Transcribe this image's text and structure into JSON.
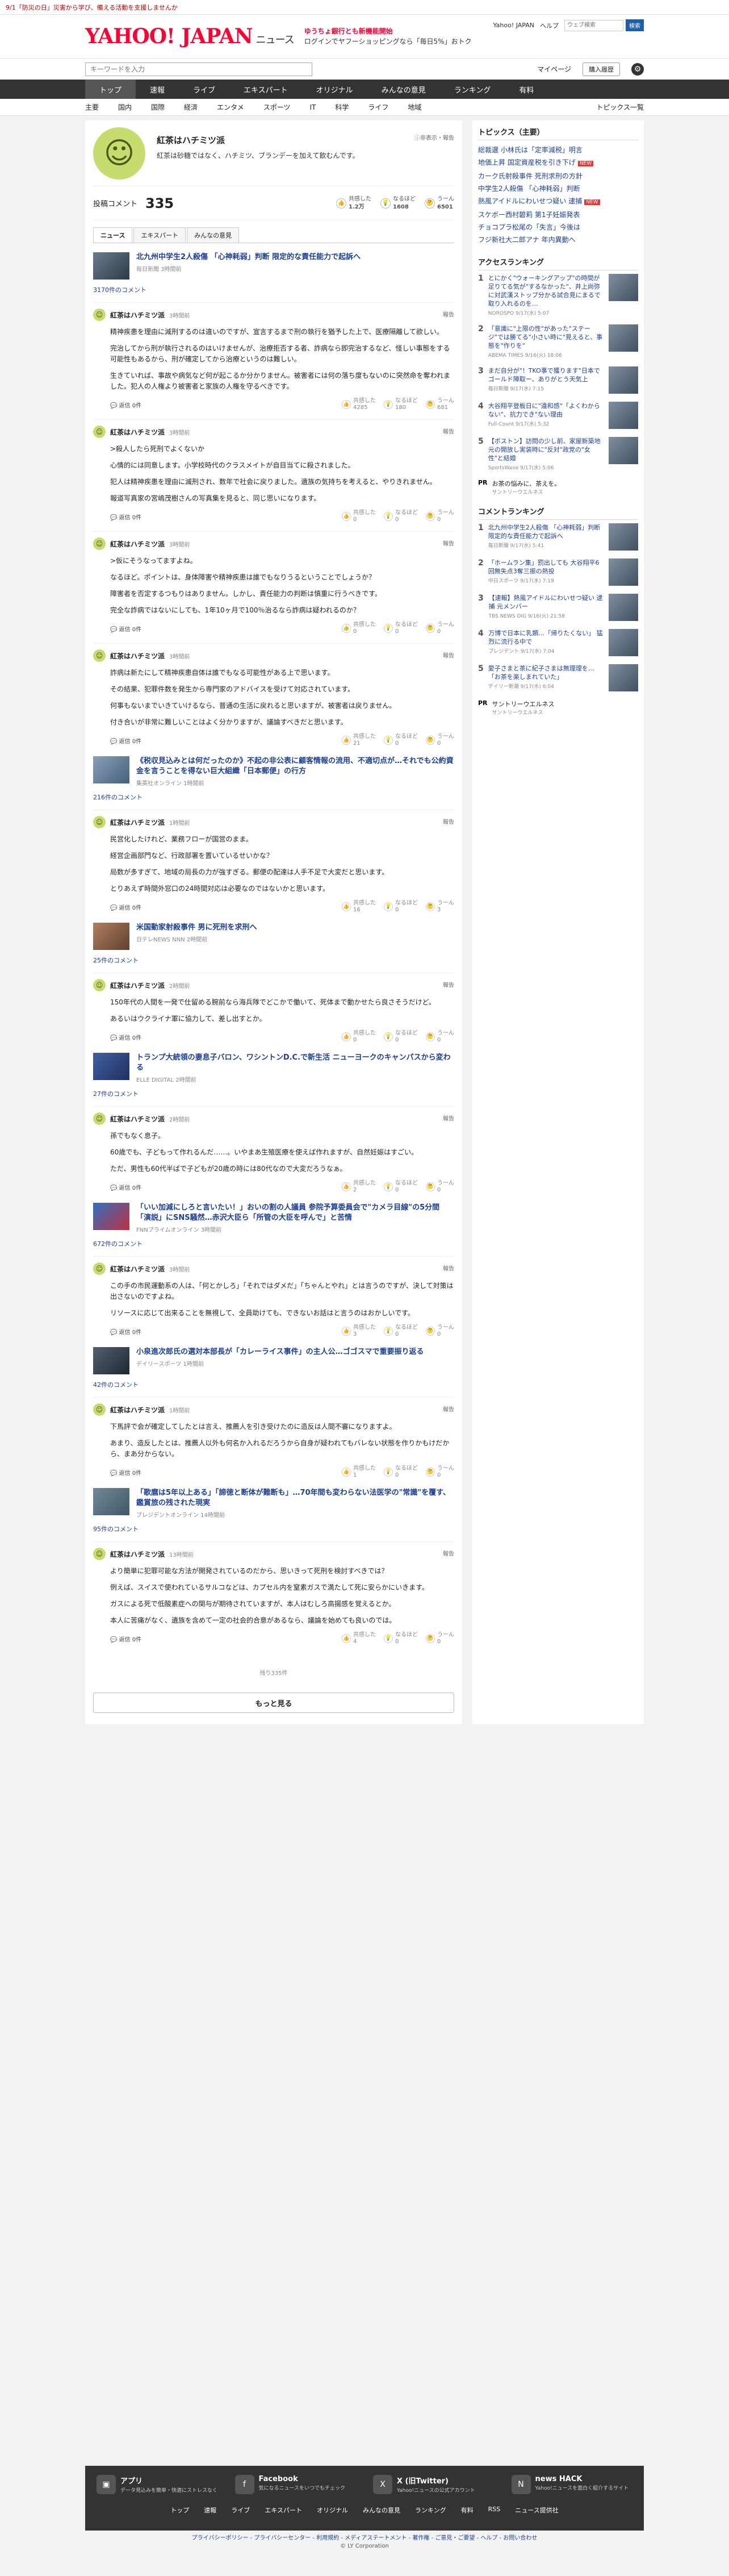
{
  "topbar": {
    "notice": "9/1「防災の日」災害から学び、備える活動を支援しませんか"
  },
  "header": {
    "logo": "YAHOO! JAPAN",
    "section": "ニュース",
    "promo_line1": "ゆうちょ銀行とも新機能開始",
    "promo_line2": "ログインでヤフーショッピングなら「毎日5%」おトク",
    "links": [
      "Yahoo! JAPAN",
      "ヘルプ"
    ],
    "search_placeholder": "ウェブ検索",
    "search_button": "検索"
  },
  "searchbar": {
    "placeholder": "キーワードを入力",
    "mypage": "マイページ",
    "entry": "購入履歴"
  },
  "nav": [
    "トップ",
    "速報",
    "ライブ",
    "エキスパート",
    "オリジナル",
    "みんなの意見",
    "ランキング",
    "有料"
  ],
  "subnav": [
    "主要",
    "国内",
    "国際",
    "経済",
    "エンタメ",
    "スポーツ",
    "IT",
    "科学",
    "ライフ",
    "地域"
  ],
  "subnav_more": "トピックス一覧",
  "profile": {
    "name": "紅茶はハチミツ派",
    "desc": "紅茶は砂糖ではなく、ハチミツ、ブランデーを加えて飲むんです。",
    "tools": "ⓘ非表示・報告",
    "post_label": "投稿コメント",
    "post_count": "335",
    "stats": [
      {
        "label": "共感した",
        "value": "1.2万"
      },
      {
        "label": "なるほど",
        "value": "1608"
      },
      {
        "label": "うーん",
        "value": "6501"
      }
    ],
    "tabs": [
      "ニュース",
      "エキスパート",
      "みんなの意見"
    ]
  },
  "feed": [
    {
      "title": "北九州中学生2人殺傷 「心神耗弱」判断 限定的な責任能力で起訴へ",
      "source": "毎日新聞 3時間前",
      "count": "3170件のコメント",
      "comment": {
        "name": "紅茶はハチミツ派",
        "time": "3時間前",
        "paras": [
          "精神疾患を理由に減刑するのは違いのですが、宣言するまで刑の執行を猶予した上で、医療隔離して欲しい。",
          "完治してから刑が執行されるのはいけませんが、治療拒否する者、詐病なら即完治するなど、怪しい事態をする可能性もあるから、刑が確定してから治療というのは難しい。",
          "生きていれば、事故や病気など何が起こるか分かりません。被害者には何の落ち度もないのに突然命を奪われました。犯人の人権より被害者と家族の人権を守るべきです。"
        ],
        "reacts": [
          "4285",
          "180",
          "681"
        ]
      }
    },
    {
      "title": "",
      "source": "",
      "count": "",
      "comment": {
        "name": "紅茶はハチミツ派",
        "time": "3時間前",
        "paras": [
          ">殺人したら死刑でよくないか",
          "心情的には同意します。小学校時代のクラスメイトが自目当てに殺されました。",
          "犯人は精神疾患を理由に減刑され、数年で社会に戻りました。遺族の気持ちを考えると、やりきれません。",
          "報道写真家の宮嶋茂樹さんの写真集を見ると、同じ思いになります。"
        ],
        "reacts": [
          "0",
          "0",
          "0"
        ]
      }
    },
    {
      "title": "",
      "source": "",
      "count": "",
      "comment": {
        "name": "紅茶はハチミツ派",
        "time": "3時間前",
        "paras": [
          ">仮にそうなってますよね。",
          "なるほど。ポイントは、身体障害や精神疾患は誰でもなりうるということでしょうか？",
          "障害者を否定するつもりはありません。しかし、責任能力の判断は慎重に行うべきです。",
          "完全な詐病ではないにしても、1年10ヶ月で100％治るなら詐病は疑われるのか？"
        ],
        "reacts": [
          "0",
          "0",
          "0"
        ]
      }
    },
    {
      "title": "",
      "source": "",
      "count": "",
      "comment": {
        "name": "紅茶はハチミツ派",
        "time": "3時間前",
        "paras": [
          "詐病は新たにして精神疾患自体は誰でもなる可能性がある上で思います。",
          "その結果、犯罪件数を発生から専門家のアドバイスを受けて対応されています。",
          "何事もないまでいきていけるなら、普通の生活に戻れると思いますが、被害者は戻りません。",
          "付き合いが非常に難しいことはよく分かりますが、議論すべきだと思います。"
        ],
        "reacts": [
          "21",
          "0",
          "0"
        ]
      }
    },
    {
      "title": "《税収見込みとは何だったのか》不起の非公表に顧客情報の流用、不適切点が…それでも公約資金を言うことを得ない巨大組織「日本郵便」の行方",
      "source": "集英社オンライン 1時間前",
      "count": "216件のコメント",
      "comment": {
        "name": "紅茶はハチミツ派",
        "time": "1時間前",
        "paras": [
          "民営化したけれど、業務フローが国営のまま。",
          "経営企画部門など、行政部署を置いているせいかな？",
          "局数が多すぎて、地域の局長の力が強すぎる。郵便の配達は人手不足で大変だと思います。",
          "とりあえず時間外窓口の24時間対応は必要なのではないかと思います。"
        ],
        "reacts": [
          "16",
          "0",
          "3"
        ]
      }
    },
    {
      "title": "米国動家射殺事件 男に死刑を求刑へ",
      "source": "日テレNEWS NNN 2時間前",
      "count": "25件のコメント",
      "comment": {
        "name": "紅茶はハチミツ派",
        "time": "2時間前",
        "paras": [
          "150年代の人間を一発で仕留める腕前なら海兵隊でどこかで働いて、死体まで動かせたら良さそうだけど。",
          "あるいはウクライナ軍に協力して、差し出すとか。"
        ],
        "reacts": [
          "0",
          "0",
          "0"
        ]
      }
    },
    {
      "title": "トランプ大統領の妻息子バロン、ワシントンD.C.で新生活 ニューヨークのキャンパスから変わる",
      "source": "ELLE DIGITAL 2時間前",
      "count": "27件のコメント",
      "comment": {
        "name": "紅茶はハチミツ派",
        "time": "2時間前",
        "paras": [
          "孫でもなく息子。",
          "60歳でも、子どもって作れるんだ……。いやまあ生殖医療を使えば作れますが、自然妊娠はすごい。",
          "ただ、男性も60代半ばで子どもが20歳の時には80代なので大変だろうなぁ。"
        ],
        "reacts": [
          "2",
          "0",
          "0"
        ]
      }
    },
    {
      "title": "「いい加減にしろと言いたい！」おいの割の人議員 参院予算委員会で\"カメラ目線\"の5分間「演説」にSNS騒然…赤沢大臣ら「所管の大臣を呼んで」と苦情",
      "source": "FNNプライムオンライン 3時間前",
      "count": "672件のコメント",
      "comment": {
        "name": "紅茶はハチミツ派",
        "time": "3時間前",
        "paras": [
          "この手の市民運動系の人は、「何とかしろ」「それではダメだ」「ちゃんとやれ」とは言うのですが、決して対策は出さないのですよね。",
          "リソースに応じて出来ることを無視して、全員助けても、できないお話はと言うのはおかしいです。"
        ],
        "reacts": [
          "3",
          "0",
          "0"
        ]
      }
    },
    {
      "title": "小泉進次郎氏の選対本部長が「カレーライス事件」の主人公…ゴゴスマで重要振り返る",
      "source": "デイリースポーツ 1時間前",
      "count": "42件のコメント",
      "comment": {
        "name": "紅茶はハチミツ派",
        "time": "1時間前",
        "paras": [
          "下馬評で会が確定してしたとは言え、推薦人を引き受けたのに造反は人間不審になりますよ。",
          "あまり、造反したとは、推薦人以外も何名か入れるだろうから自身が疑われてもバレない状態を作りかもけだから、まあ分からない。"
        ],
        "reacts": [
          "1",
          "0",
          "0"
        ]
      }
    },
    {
      "title": "「歌麿は5年以上ある」「諦徳と断体が難断も」…70年間も変わらない法医学の\"常識\"を覆す、鑑賞旅の残された現実",
      "source": "プレジデントオンライン 14時間前",
      "count": "95件のコメント",
      "comment": {
        "name": "紅茶はハチミツ派",
        "time": "13時間前",
        "paras": [
          "より簡単に犯罪可能な方法が開発されているのだから、思いきって死刑を検討すべきでは？",
          "例えば、スイスで使われているサルコなどは、カプセル内を窒素ガスで満たして死に安らかにいきます。",
          "ガスによる死で低酸素症への関与が期待されていますが、本人はむしろ高揚感を覚えるとか。",
          "本人に苦痛がなく、遺族を含めて一定の社会的合意があるなら、議論を始めても良いのでは。"
        ],
        "reacts": [
          "4",
          "0",
          "0"
        ]
      }
    }
  ],
  "pager": "残り335件",
  "more": "もっと見る",
  "side": {
    "topics_title": "トピックス（主要）",
    "topics": [
      {
        "t": "総裁選 小林氏は「定率減税」明言",
        "n": ""
      },
      {
        "t": "地価上昇 国定資産税を引き下げ",
        "n": "NEW"
      },
      {
        "t": "カーク氏射殺事件 死刑求刑の方針",
        "n": ""
      },
      {
        "t": "中学生2人殺傷 「心神耗弱」判断",
        "n": ""
      },
      {
        "t": "熱風アイドルにわいせつ疑い 逮捕",
        "n": "NEW"
      },
      {
        "t": "スケボー西村碧莉 第1子妊娠発表",
        "n": ""
      },
      {
        "t": "チョコプラ松尾の「失言」今後は",
        "n": ""
      },
      {
        "t": "フジ新社大二郎アナ 年内異動へ",
        "n": ""
      }
    ],
    "access_title": "アクセスランキング",
    "access": [
      {
        "t": "とにかく\"ウォーキングアップ\"の時間が足りてる気が\"するなかった\"、井上尚弥に対武漢ストップ分かる試合見にまるで取り入れるのを…",
        "m": "NOROSPO 9/17(水) 5:07"
      },
      {
        "t": "「意識に\"上限の性\"があった\"ステージ\"では勝てる\"小さい時に\"見えると、事態を\"作りを\"",
        "m": "ABEMA TIMES 9/16(火) 18:06"
      },
      {
        "t": "まだ自分が\"！TKO事で獲ります\"日本でゴールド陣取ー、ありがとう天気上",
        "m": "毎日新聞 9/17(水) 7:15"
      },
      {
        "t": "大谷翔平登板日に\"違和感\"「よくわからない\"、抗力でき\"ない理由",
        "m": "Full-Count 9/17(水) 5:32"
      },
      {
        "t": "【ボストン】訪問の少し前、家屋新築地元の開放し実装時に\"反対\"政党の\"女性\"と結婚",
        "m": "SportsWave 9/17(水) 5:06"
      }
    ],
    "pr1_label": "PR",
    "pr1_title": "お茶の悩みに、茶えを。",
    "pr1_src": "サントリーウエルネス",
    "comment_title": "コメントランキング",
    "comment": [
      {
        "t": "北九州中学生2人殺傷 「心神耗弱」判断 限定的な責任能力で起訴へ",
        "m": "毎日新聞 9/17(水) 5:41"
      },
      {
        "t": "「ホームラン集」罰出しても 大谷翔平6回無失点3奪三振の熱投",
        "m": "中日スポーツ 9/17(水) 7:19"
      },
      {
        "t": "【速報】熱風アイドルにわいせつ疑い 逮捕 元メンバー",
        "m": "TBS NEWS DIG 9/16(火) 21:58"
      },
      {
        "t": "万博で日本に乳類…「帰りたくない」 猛烈に流行る中で",
        "m": "プレジデント 9/17(水) 7:04"
      },
      {
        "t": "愛子さまと茶に紀子さまは無理理を…「お茶を楽しまれていた」",
        "m": "デイリー新潮 9/17(水) 6:04"
      }
    ],
    "pr2_label": "PR",
    "pr2_title": "サントリーウエルネス",
    "pr2_src": "サントリーウエルネス"
  },
  "footer": {
    "cols": [
      {
        "ttl": "アプリ",
        "dsc": "データ見込みを簡単・快適にストレスなく"
      },
      {
        "ttl": "Facebook",
        "dsc": "気になるニュースをいつでもチェック"
      },
      {
        "ttl": "X (旧Twitter)",
        "dsc": "Yahoo!ニュースの公式アカウント"
      },
      {
        "ttl": "news HACK",
        "dsc": "Yahoo!ニュースを面白く紹介するサイト"
      }
    ],
    "links": [
      "トップ",
      "速報",
      "ライブ",
      "エキスパート",
      "オリジナル",
      "みんなの意見",
      "ランキング",
      "有料",
      "RSS",
      "ニュース提供社"
    ],
    "legal": "プライバシーポリシー - プライバシーセンター - 利用規約 - メディアステートメント - 著作権 - ご意見・ご要望 - ヘルプ - お問い合わせ",
    "copy": "© LY Corporation"
  }
}
